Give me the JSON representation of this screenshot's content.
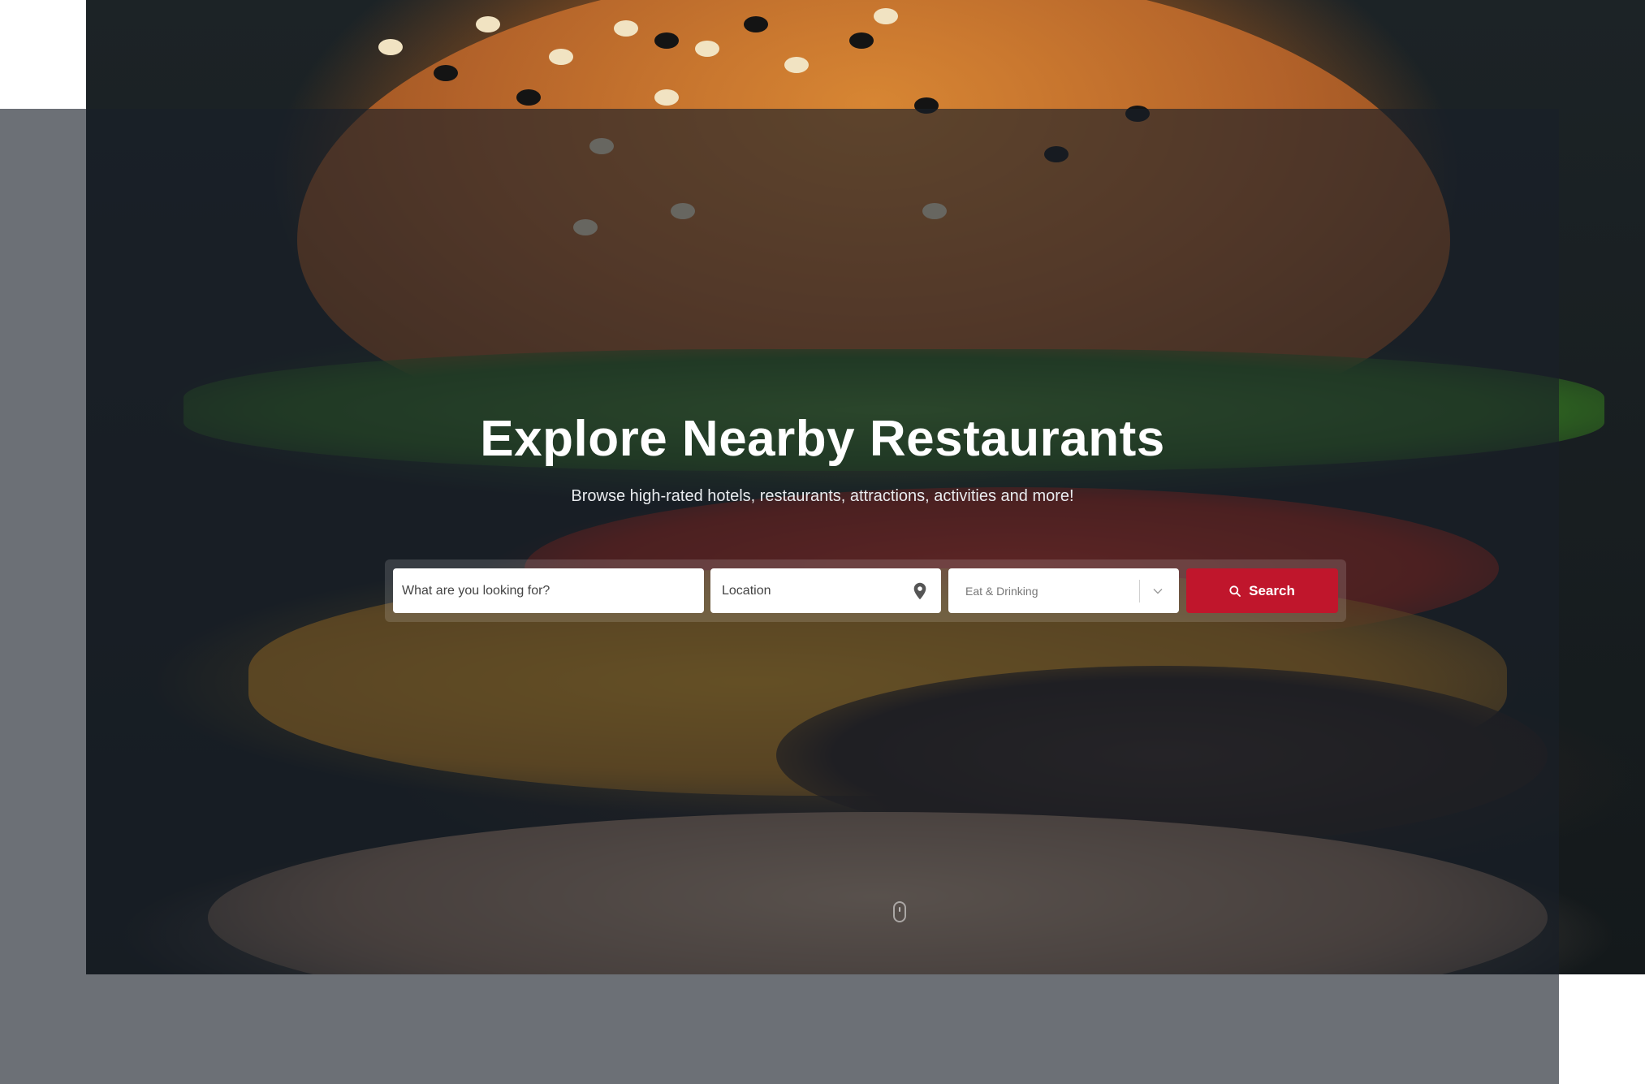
{
  "hero": {
    "title": "Explore Nearby Restaurants",
    "subtitle": "Browse high-rated hotels, restaurants, attractions, activities and more!"
  },
  "search": {
    "what_placeholder": "What are you looking for?",
    "location_placeholder": "Location",
    "category_selected": "Eat & Drinking",
    "button_label": "Search"
  },
  "icons": {
    "location": "map-pin-icon",
    "dropdown": "chevron-down-icon",
    "search": "search-icon",
    "scroll": "mouse-scroll-icon"
  },
  "colors": {
    "accent": "#c0162c",
    "overlay": "rgba(25, 32, 40, 0.64)"
  }
}
